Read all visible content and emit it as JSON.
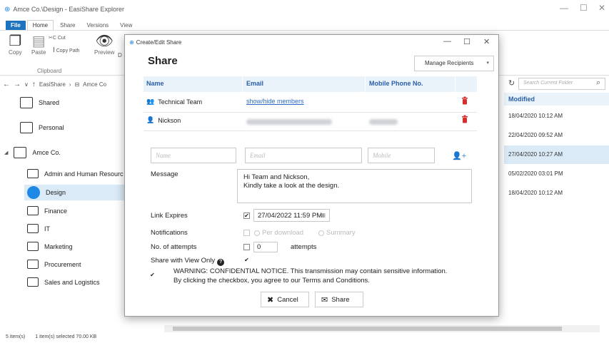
{
  "window": {
    "title": "Amce Co.\\Design - EasiShare Explorer",
    "controls": {
      "minimize": "—",
      "maximize": "☐",
      "close": "✕"
    }
  },
  "ribbon": {
    "tabs": [
      "File",
      "Home",
      "Share",
      "Versions",
      "View"
    ],
    "copy_label": "Copy",
    "paste_label": "Paste",
    "cut_label": "Cut",
    "copy_path_label": "Copy Path",
    "preview_label": "Preview",
    "preview_extra": "D",
    "clipboard_group": "Clipboard"
  },
  "navbar": {
    "back": "←",
    "forward": "→",
    "down": "∨",
    "up": "↑",
    "crumb1": "EasiShare",
    "crumb_sep": "›",
    "crumb2": "Amce Co",
    "search_placeholder": "Search Current Folder"
  },
  "tree": {
    "shared": "Shared",
    "personal": "Personal",
    "amce": "Amce Co.",
    "children": [
      "Admin and Human Resourc",
      "Design",
      "Finance",
      "IT",
      "Marketing",
      "Procurement",
      "Sales and Logistics"
    ]
  },
  "list": {
    "modified_header": "Modified",
    "dates": [
      "18/04/2020 10:12 AM",
      "22/04/2020 09:52 AM",
      "27/04/2020 10:27 AM",
      "05/02/2020 03:01 PM",
      "18/04/2020 10:12 AM"
    ]
  },
  "status": {
    "items": "5 item(s)",
    "selected": "1 item(s) selected 70.00 KB"
  },
  "dialog": {
    "title": "Create/Edit Share",
    "heading": "Share",
    "manage_recipients": "Manage Recipients",
    "columns": {
      "name": "Name",
      "email": "Email",
      "mobile": "Mobile Phone No."
    },
    "recipients": [
      {
        "name": "Technical Team",
        "email": "show/hide members"
      },
      {
        "name": "Nickson"
      }
    ],
    "inputs": {
      "name_placeholder": "Name",
      "email_placeholder": "Email",
      "mobile_placeholder": "Mobile"
    },
    "message_label": "Message",
    "message_line1": "Hi Team and Nickson,",
    "message_line2": "Kindly take a look at the design.",
    "link_expires_label": "Link Expires",
    "link_expires_value": "27/04/2022 11:59 PM",
    "notifications_label": "Notifications",
    "per_download": "Per download",
    "summary": "Summary",
    "attempts_label": "No. of attempts",
    "attempts_value": "0",
    "attempts_suffix": "attempts",
    "view_only_label": "Share with View Only",
    "warning_line1": "WARNING: CONFIDENTIAL NOTICE. This transmission may contain sensitive information.",
    "warning_line2": "By clicking the checkbox, you agree to our Terms and Conditions.",
    "cancel_label": "Cancel",
    "share_label": "Share"
  }
}
